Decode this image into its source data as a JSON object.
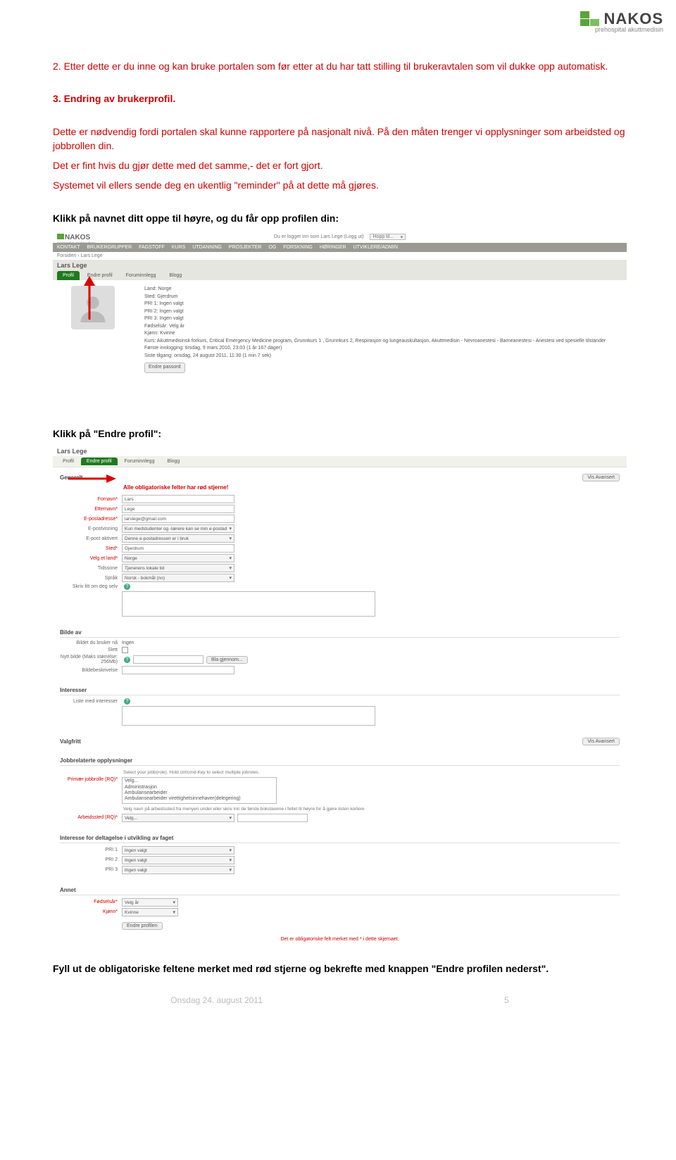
{
  "logo": {
    "word": "NAKOS",
    "sub": "prehospital akuttmedisin"
  },
  "doc": {
    "p1": "2. Etter dette er du inne og kan bruke portalen som før etter at du har tatt stilling til brukeravtalen som vil dukke opp automatisk.",
    "h3": "3. Endring av brukerprofil.",
    "p2a": "Dette er nødvendig fordi portalen skal kunne rapportere på nasjonalt nivå. På den måten trenger vi opplysninger som arbeidsted og jobbrollen din.",
    "p2b": "Det er fint hvis du gjør dette med det samme,- det er fort gjort.",
    "p2c": "Systemet vil ellers sende deg en ukentlig \"reminder\" på at dette må gjøres.",
    "p3": "Klikk på navnet ditt oppe til høyre, og du får opp profilen din:",
    "p4": "Klikk på \"Endre profil\":",
    "p5": "Fyll ut de obligatoriske feltene merket med rød stjerne og bekrefte med knappen \"Endre profilen nederst\"."
  },
  "shot1": {
    "logged_in": "Du er logget inn som Lars Lege (Logg ut)",
    "jump": "Hopp til...",
    "nav": "KONTAKT   BRUKERGRUPPER   FAGSTOFF   KURS   UTDANNING   PROSJEKTER OG FORSKNING   HØRINGER   UTVIKLERE/ADMIN",
    "breadcrumb": "Forsiden › Lars Lege",
    "user": "Lars Lege",
    "tabs": [
      "Profil",
      "Endre profil",
      "Foruminnlegg",
      "Blogg"
    ],
    "fields": {
      "land": "Land: Norge",
      "sted": "Sted: Gjerdrum",
      "pri1": "PRI 1: Ingen valgt",
      "pri2": "PRI 2: Ingen valgt",
      "pri3": "PRI 3: Ingen valgt",
      "fodselsar": "Fødselsår: Velg år",
      "kjonn": "Kjønn: Kvinne",
      "kurs": "Kurs: Akuttmedisinsk forkurs, Critical Emergency Medicine program, Grunnkurs 1 , Grunnkurs 2, Respirasjon og lungeauskultasjon, Akuttmedisin - Nevroanestesi - Barneanestesi - Anestesi ved spesielle tilstander",
      "forste": "Første innlogging: tirsdag, 9 mars 2010, 23:03  (1 år 167 dager)",
      "siste": "Siste tilgang: onsdag, 24 august 2011, 11:30  (1 min 7 sek)"
    },
    "btn": "Endre passord"
  },
  "shot2": {
    "user": "Lars Lege",
    "tabs": [
      "Profil",
      "Endre profil",
      "Foruminnlegg",
      "Blogg"
    ],
    "sec_general": "Generelt",
    "warn": "Alle obligatoriske felter har rød stjerne!",
    "btn_adv": "Vis Avansert",
    "rows": {
      "fornavn": {
        "label": "Fornavn*",
        "value": "Lars"
      },
      "etternavn": {
        "label": "Etternavn*",
        "value": "Lege"
      },
      "epost": {
        "label": "E-postadresse*",
        "value": "larslege@gmail.com"
      },
      "epostvisning": {
        "label": "E-postvisning",
        "value": "Kun medstudenter og -lærere kan se min e-postad"
      },
      "epostaktiv": {
        "label": "E-post aktivert",
        "value": "Denne e-postadressen er i bruk"
      },
      "sted": {
        "label": "Sted*",
        "value": "Gjerdrum"
      },
      "land": {
        "label": "Velg et land*",
        "value": "Norge"
      },
      "tidssone": {
        "label": "Tidssone",
        "value": "Tjenerens lokale tid"
      },
      "sprak": {
        "label": "Språk",
        "value": "Norsk - bokmål (no)"
      },
      "beskriv": {
        "label": "Skriv litt om deg selv"
      }
    },
    "sec_bilde": "Bilde av",
    "bilde_row1": {
      "label": "Bildet du bruker nå",
      "value": "Ingen"
    },
    "bilde_row2": {
      "label": "Slett",
      "value": ""
    },
    "bilde_row3": {
      "label": "Nytt bilde (Maks størrelse: 256Mb)",
      "btn": "Bla gjennom..."
    },
    "bilde_row4": {
      "label": "Bildebeskrivelse"
    },
    "sec_interesser": "Interesser",
    "int_row": {
      "label": "Liste med interesser"
    },
    "sec_valgfritt": "Valgfritt",
    "sec_jobb": "Jobbrelaterte opplysninger",
    "jobb_help1": "Select your jobb(role). Hold ctrl/cmd-Key to select multiple jobroles.",
    "jobb_row1": {
      "label": "Primær jobbrolle (RQ)*",
      "options": [
        "Velg...",
        "Administrasjon",
        "Ambulansearbeider",
        "Ambulansearbeider virettighetsinnehaver(delegering)"
      ]
    },
    "jobb_help2": "Velg navn på arbeidssted fra menyen under eller skriv inn de første bokstavene i feltet til høyre for å gjøre listen kortere",
    "jobb_row2": {
      "label": "Arbeidssted (RQ)*",
      "value": "Velg..."
    },
    "sec_pri": "Interesse for deltagelse i utvikling av faget",
    "pri1": {
      "label": "PRI 1",
      "value": "Ingen valgt"
    },
    "pri2": {
      "label": "PRI 2",
      "value": "Ingen valgt"
    },
    "pri3": {
      "label": "PRI 3",
      "value": "Ingen valgt"
    },
    "sec_annet": "Annet",
    "annet1": {
      "label": "Fødselsår*",
      "value": "Velg år"
    },
    "annet2": {
      "label": "Kjønn*",
      "value": "Kvinne"
    },
    "btn_save": "Endre profilen",
    "foot": "Det er obligatoriske felt merket med * i dette skjemaet."
  },
  "footer": {
    "date": "Onsdag 24. august 2011",
    "page": "5"
  }
}
